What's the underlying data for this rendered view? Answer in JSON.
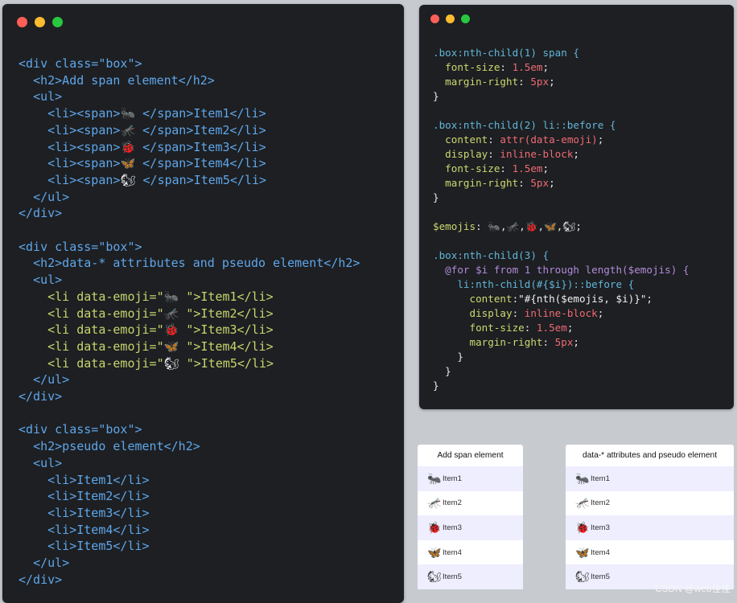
{
  "window_colors": {
    "close": "#fe5f57",
    "minimize": "#febc2e",
    "maximize": "#28c840"
  },
  "emojis": {
    "ant": "🐜",
    "mosquito": "🦟",
    "ladybug": "🐞",
    "butterfly": "🦋",
    "squirrel": "🐿"
  },
  "html_code": {
    "box1": {
      "div_open": "<div class=\"box\">",
      "h2": "<h2>Add span element</h2>",
      "ul_open": "<ul>",
      "items": [
        {
          "pre": "<li><span>",
          "post": " </span>Item1</li>"
        },
        {
          "pre": "<li><span>",
          "post": " </span>Item2</li>"
        },
        {
          "pre": "<li><span>",
          "post": " </span>Item3</li>"
        },
        {
          "pre": "<li><span>",
          "post": " </span>Item4</li>"
        },
        {
          "pre": "<li><span>",
          "post": " </span>Item5</li>"
        }
      ],
      "ul_close": "</ul>",
      "div_close": "</div>"
    },
    "box2": {
      "div_open": "<div class=\"box\">",
      "h2": "<h2>data-* attributes and pseudo element</h2>",
      "ul_open": "<ul>",
      "items": [
        {
          "pre": "<li data-emoji=\"",
          "post": " \">Item1</li>"
        },
        {
          "pre": "<li data-emoji=\"",
          "post": " \">Item2</li>"
        },
        {
          "pre": "<li data-emoji=\"",
          "post": " \">Item3</li>"
        },
        {
          "pre": "<li data-emoji=\"",
          "post": " \">Item4</li>"
        },
        {
          "pre": "<li data-emoji=\"",
          "post": " \">Item5</li>"
        }
      ],
      "ul_close": "</ul>",
      "div_close": "</div>"
    },
    "box3": {
      "div_open": "<div class=\"box\">",
      "h2": "<h2>pseudo element</h2>",
      "ul_open": "<ul>",
      "items": [
        "<li>Item1</li>",
        "<li>Item2</li>",
        "<li>Item3</li>",
        "<li>Item4</li>",
        "<li>Item5</li>"
      ],
      "ul_close": "</ul>",
      "div_close": "</div>"
    }
  },
  "css_code": {
    "rule1": {
      "selector": ".box:nth-child(1) span {",
      "decls": [
        {
          "prop": "font-size",
          "value": "1.5em"
        },
        {
          "prop": "margin-right",
          "value": "5px"
        }
      ],
      "close": "}"
    },
    "rule2": {
      "selector": ".box:nth-child(2) li::before {",
      "decls": [
        {
          "prop": "content",
          "value": "attr(data-emoji)"
        },
        {
          "prop": "display",
          "value": "inline-block"
        },
        {
          "prop": "font-size",
          "value": "1.5em"
        },
        {
          "prop": "margin-right",
          "value": "5px"
        }
      ],
      "close": "}"
    },
    "emojis_var": "$emojis",
    "rule3": {
      "selector": ".box:nth-child(3) {",
      "for_line": "@for $i from 1 through length($emojis) {",
      "inner_selector": "li:nth-child(#{$i})::before {",
      "decls": [
        {
          "prop": "content",
          "value": "\"#{nth($emojis, $i)}\""
        },
        {
          "prop": "display",
          "value": "inline-block"
        },
        {
          "prop": "font-size",
          "value": "1.5em"
        },
        {
          "prop": "margin-right",
          "value": "5px"
        }
      ],
      "close": "}"
    }
  },
  "demos": [
    {
      "title": "Add span element",
      "items": [
        "Item1",
        "Item2",
        "Item3",
        "Item4",
        "Item5"
      ]
    },
    {
      "title": "data-* attributes and pseudo element",
      "items": [
        "Item1",
        "Item2",
        "Item3",
        "Item4",
        "Item5"
      ]
    }
  ],
  "watermark": "CSDN @web佳佳"
}
